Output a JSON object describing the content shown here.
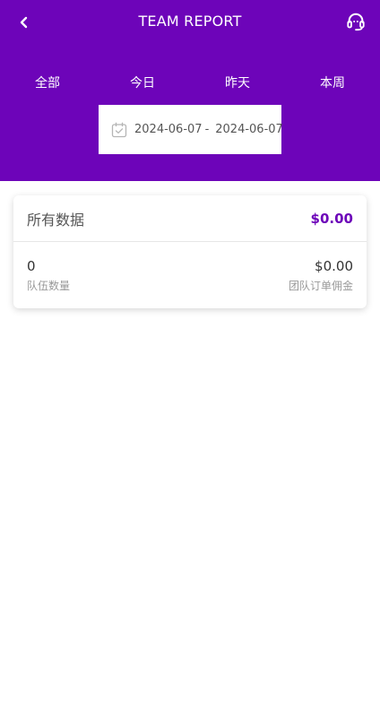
{
  "header": {
    "title": "TEAM REPORT",
    "bg_color": "#6d04b9",
    "back_icon": "chevron-left-icon",
    "support_icon": "headset-icon"
  },
  "filters": {
    "tabs": [
      "全部",
      "今日",
      "昨天",
      "本周"
    ]
  },
  "date_range": {
    "icon": "calendar-check-icon",
    "start": "2024-06-07",
    "separator": "-",
    "end": "2024-06-07"
  },
  "summary_card": {
    "title": "所有数据",
    "total": "$0.00",
    "team_count_value": "0",
    "team_count_label": "队伍数量",
    "commission_value": "$0.00",
    "commission_label": "团队订单佣金"
  }
}
